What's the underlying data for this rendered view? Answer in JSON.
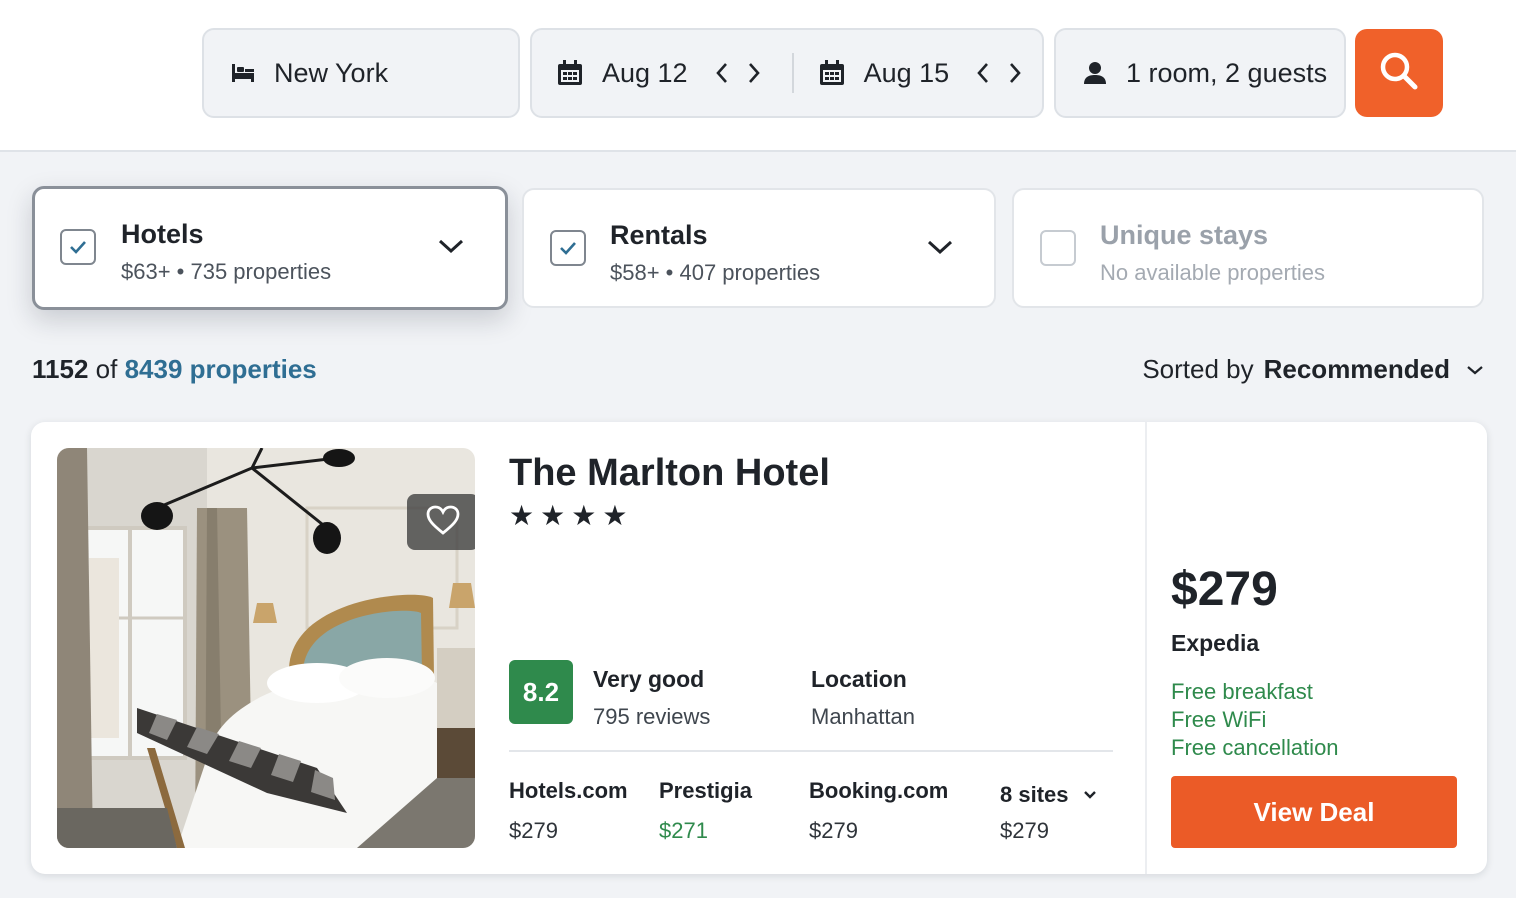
{
  "search": {
    "destination": "New York",
    "checkin": "Aug 12",
    "checkout": "Aug 15",
    "guests": "1 room, 2 guests"
  },
  "filters": [
    {
      "title": "Hotels",
      "sub": "$63+ • 735 properties",
      "checked": true
    },
    {
      "title": "Rentals",
      "sub": "$58+ • 407 properties",
      "checked": true
    },
    {
      "title": "Unique stays",
      "sub": "No available properties",
      "checked": false
    }
  ],
  "results": {
    "shown": "1152",
    "of": "of",
    "total": "8439 properties",
    "sort_label": "Sorted by",
    "sort_value": "Recommended"
  },
  "hotel": {
    "name": "The Marlton Hotel",
    "stars": 4,
    "star_glyph": "★",
    "score": "8.2",
    "rating_label": "Very good",
    "reviews": "795 reviews",
    "location_label": "Location",
    "location": "Manhattan",
    "sites": [
      {
        "name": "Hotels.com",
        "price": "$279",
        "best": false
      },
      {
        "name": "Prestigia",
        "price": "$271",
        "best": true
      },
      {
        "name": "Booking.com",
        "price": "$279",
        "best": false
      }
    ],
    "more_sites": {
      "name": "8 sites",
      "price": "$279"
    },
    "price": "$279",
    "provider": "Expedia",
    "perks": [
      "Free breakfast",
      "Free WiFi",
      "Free cancellation"
    ],
    "cta": "View Deal"
  },
  "colors": {
    "accent": "#f0612a",
    "deal_button": "#eb5b27",
    "score_green": "#2f8a4c",
    "link_blue": "#2f6e93"
  },
  "icons": [
    "bed-icon",
    "calendar-icon",
    "chevron-left-icon",
    "chevron-right-icon",
    "person-icon",
    "search-icon",
    "check-icon",
    "chevron-down-icon",
    "heart-icon",
    "star-icon"
  ]
}
